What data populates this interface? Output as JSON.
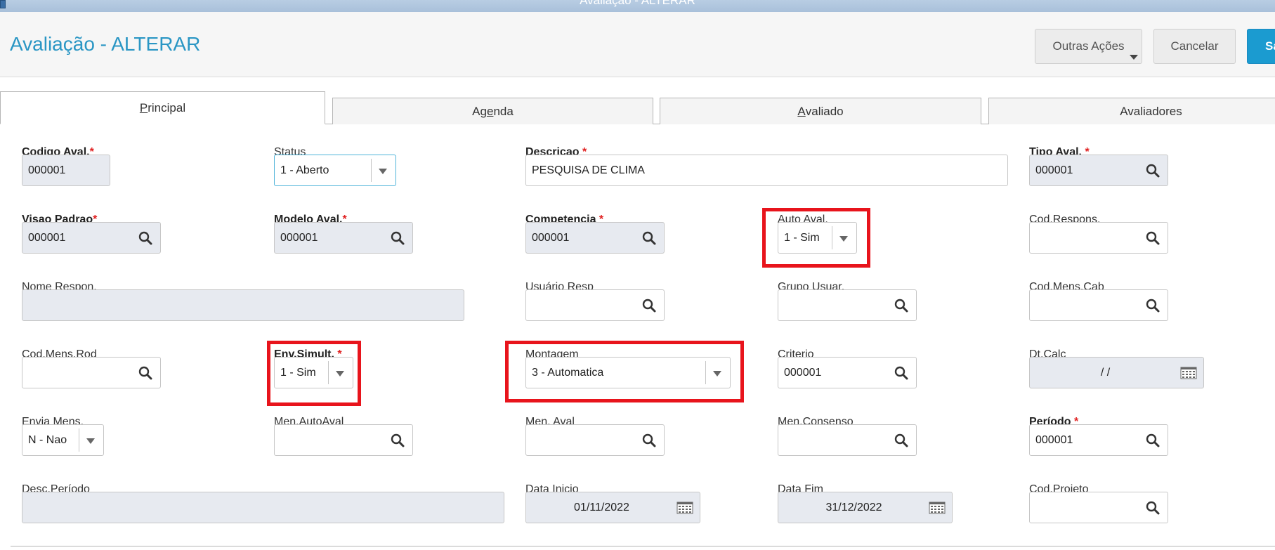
{
  "window": {
    "title": "Avaliação - ALTERAR"
  },
  "header": {
    "title": "Avaliação - ALTERAR",
    "buttons": {
      "other_actions": "Outras Ações",
      "cancel": "Cancelar",
      "save": "Sa"
    }
  },
  "tabs": [
    {
      "prefix": "",
      "underlined": "P",
      "rest": "rincipal"
    },
    {
      "prefix": "Ag",
      "underlined": "e",
      "rest": "nda"
    },
    {
      "prefix": "",
      "underlined": "A",
      "rest": "valiado"
    },
    {
      "prefix": "Avaliadores",
      "underlined": "",
      "rest": ""
    }
  ],
  "fields": {
    "codigo_aval": {
      "label": "Codigo Aval.",
      "value": "000001"
    },
    "status": {
      "label": "Status",
      "value": "1 - Aberto"
    },
    "descricao": {
      "label": "Descricao",
      "value": "PESQUISA DE CLIMA"
    },
    "tipo_aval": {
      "label": "Tipo Aval.",
      "value": "000001"
    },
    "visao_padrao": {
      "label": "Visao Padrao",
      "value": "000001"
    },
    "modelo_aval": {
      "label": "Modelo Aval.",
      "value": "000001"
    },
    "competencia": {
      "label": "Competencia",
      "value": "000001"
    },
    "auto_aval": {
      "label": "Auto Aval.",
      "value": "1 - Sim"
    },
    "cod_respons": {
      "label": "Cod.Respons.",
      "value": ""
    },
    "nome_respon": {
      "label": "Nome Respon.",
      "value": ""
    },
    "usuario_resp": {
      "label": "Usuário Resp",
      "value": ""
    },
    "grupo_usuar": {
      "label": "Grupo Usuar.",
      "value": ""
    },
    "cod_mens_cab": {
      "label": "Cod.Mens.Cab",
      "value": ""
    },
    "cod_mens_rod": {
      "label": "Cod.Mens.Rod",
      "value": ""
    },
    "env_simult": {
      "label": "Env.Simult.",
      "value": "1 - Sim"
    },
    "montagem": {
      "label": "Montagem",
      "value": "3 - Automatica"
    },
    "criterio": {
      "label": "Criterio",
      "value": "000001"
    },
    "dt_calc": {
      "label": "Dt.Calc",
      "value": "/ /"
    },
    "envia_mens": {
      "label": "Envia Mens.",
      "value": "N - Nao"
    },
    "men_autoaval": {
      "label": "Men.AutoAval",
      "value": ""
    },
    "men_aval": {
      "label": "Men. Aval",
      "value": ""
    },
    "men_consenso": {
      "label": "Men.Consenso",
      "value": ""
    },
    "periodo": {
      "label": "Período",
      "value": "000001"
    },
    "desc_periodo": {
      "label": "Desc.Período",
      "value": ""
    },
    "data_inicio": {
      "label": "Data Inicio",
      "value": "01/11/2022"
    },
    "data_fim": {
      "label": "Data Fim",
      "value": "31/12/2022"
    },
    "cod_projeto": {
      "label": "Cod.Projeto",
      "value": ""
    }
  },
  "required_mark": "*",
  "colors": {
    "accent": "#2a96c4",
    "highlight": "#e8141c",
    "required": "#e02020"
  }
}
